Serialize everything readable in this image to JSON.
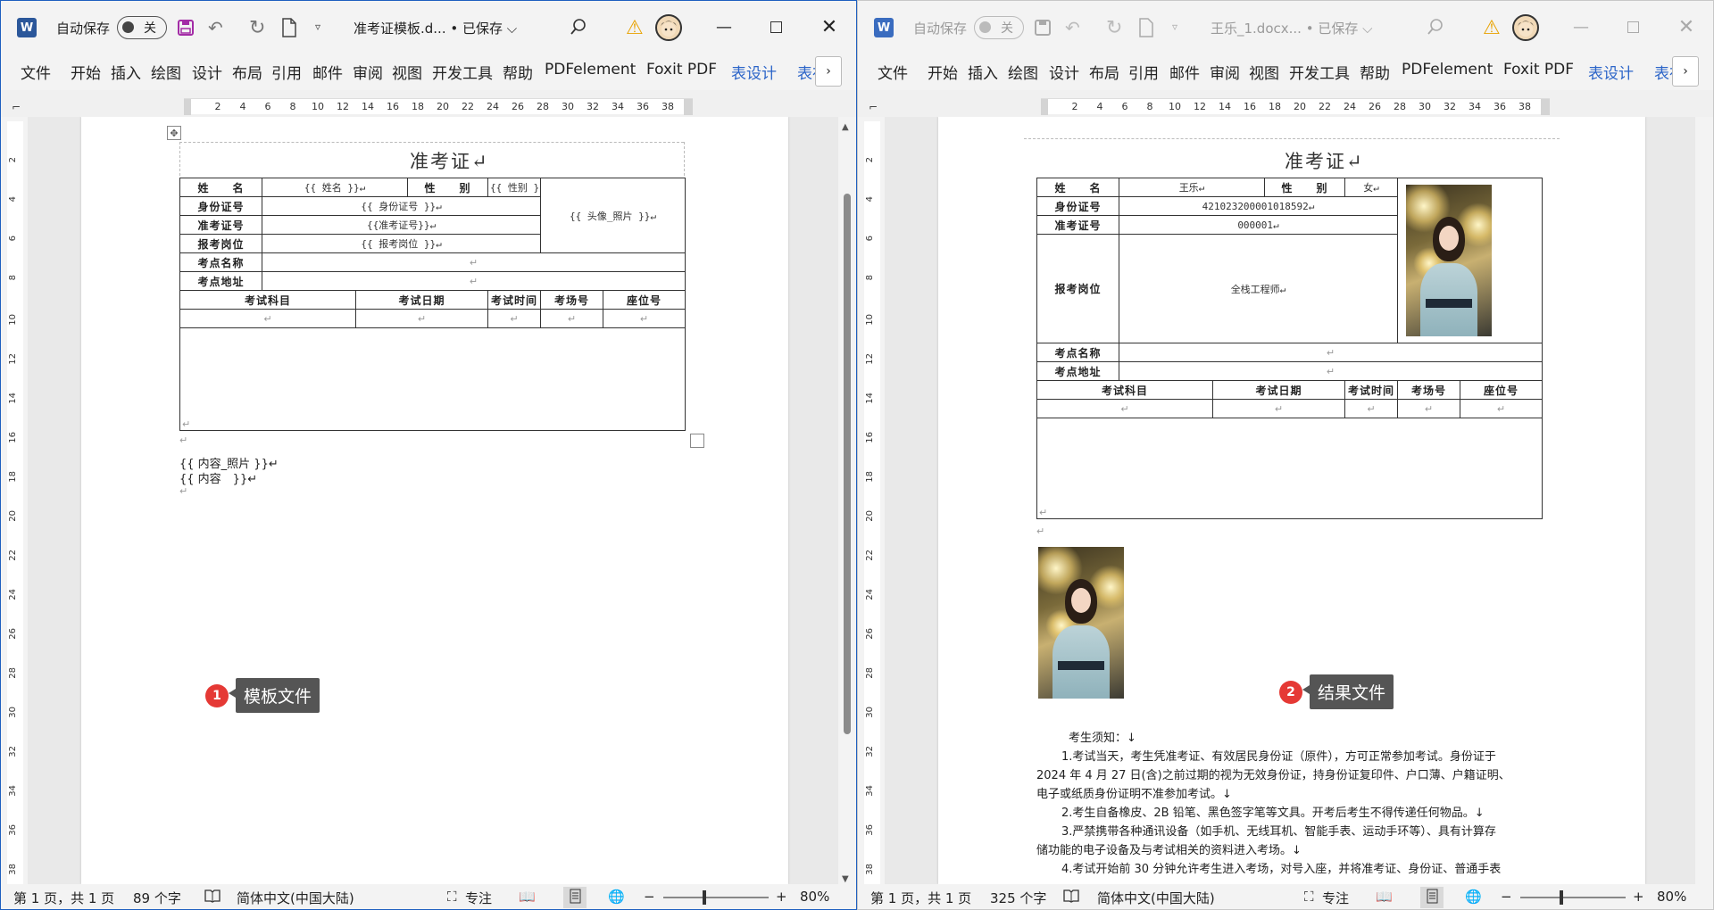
{
  "left_window": {
    "autosave_label": "自动保存",
    "autosave_state": "关",
    "doc_title": "准考证模板.d... • 已保存 ⌵",
    "ribbon_tabs": [
      "文件",
      "开始",
      "插入",
      "绘图",
      "设计",
      "布局",
      "引用",
      "邮件",
      "审阅",
      "视图",
      "开发工具",
      "帮助",
      "PDFelement",
      "Foxit PDF",
      "表设计",
      "表布"
    ],
    "card_title": "准考证↵",
    "table": {
      "name_label": "姓　　名",
      "name_value": "{{ 姓名 }}↵",
      "gender_label": "性　　别",
      "gender_value": "{{ 性别 }}↵",
      "photo_placeholder": "{{ 头像_照片 }}↵",
      "id_label": "身份证号",
      "id_value": "{{ 身份证号 }}↵",
      "ticket_label": "准考证号",
      "ticket_value": "{{准考证号}}↵",
      "position_label": "报考岗位",
      "position_value": "{{ 报考岗位 }}↵",
      "site_name_label": "考点名称",
      "site_addr_label": "考点地址",
      "col_subject": "考试科目",
      "col_date": "考试日期",
      "col_time": "考试时间",
      "col_room": "考场号",
      "col_seat": "座位号",
      "para_mark": "↵"
    },
    "body_lines": [
      "{{ 内容_照片 }}↵",
      "{{ 内容　}}↵"
    ],
    "status": {
      "page": "第 1 页，共 1 页",
      "words": "89 个字",
      "language": "简体中文(中国大陆)",
      "focus": "专注",
      "zoom": "80%"
    },
    "callout": {
      "num": "1",
      "text": "模板文件"
    }
  },
  "right_window": {
    "autosave_label": "自动保存",
    "autosave_state": "关",
    "doc_title": "王乐_1.docx... • 已保存 ⌵",
    "ribbon_tabs": [
      "文件",
      "开始",
      "插入",
      "绘图",
      "设计",
      "布局",
      "引用",
      "邮件",
      "审阅",
      "视图",
      "开发工具",
      "帮助",
      "PDFelement",
      "Foxit PDF",
      "表设计",
      "表布"
    ],
    "card_title": "准考证↵",
    "table": {
      "name_label": "姓　　名",
      "name_value": "王乐↵",
      "gender_label": "性　　别",
      "gender_value": "女↵",
      "id_label": "身份证号",
      "id_value": "421023200001018592↵",
      "ticket_label": "准考证号",
      "ticket_value": "000001↵",
      "position_label": "报考岗位",
      "position_value": "全栈工程师↵",
      "site_name_label": "考点名称",
      "site_addr_label": "考点地址",
      "col_subject": "考试科目",
      "col_date": "考试日期",
      "col_time": "考试时间",
      "col_room": "考场号",
      "col_seat": "座位号",
      "para_mark": "↵"
    },
    "notice_title": "考生须知：↓",
    "notice_lines": [
      "1.考试当天，考生凭准考证、有效居民身份证（原件），方可正常参加考试。身份证于",
      "2024 年 4 月 27 日(含)之前过期的视为无效身份证，持身份证复印件、户口薄、户籍证明、",
      "电子或纸质身份证明不准参加考试。↓",
      "2.考生自备橡皮、2B 铅笔、黑色签字笔等文具。开考后考生不得传递任何物品。↓",
      "3.严禁携带各种通讯设备（如手机、无线耳机、智能手表、运动手环等）、具有计算存",
      "储功能的电子设备及与考试相关的资料进入考场。↓",
      "4.考试开始前 30 分钟允许考生进入考场，对号入座，并将准考证、身份证、普通手表"
    ],
    "status": {
      "page": "第 1 页，共 1 页",
      "words": "325 个字",
      "language": "简体中文(中国大陆)",
      "focus": "专注",
      "zoom": "80%"
    },
    "callout": {
      "num": "2",
      "text": "结果文件"
    }
  },
  "ruler_ticks": [
    "2",
    "4",
    "6",
    "8",
    "10",
    "12",
    "14",
    "16",
    "18",
    "20",
    "22",
    "24",
    "26",
    "28",
    "30",
    "32",
    "34",
    "36",
    "38"
  ],
  "vruler_ticks": [
    "2",
    "4",
    "6",
    "8",
    "10",
    "12",
    "14",
    "16",
    "18",
    "20",
    "22",
    "24",
    "26",
    "28",
    "30",
    "32",
    "34",
    "36",
    "38"
  ]
}
